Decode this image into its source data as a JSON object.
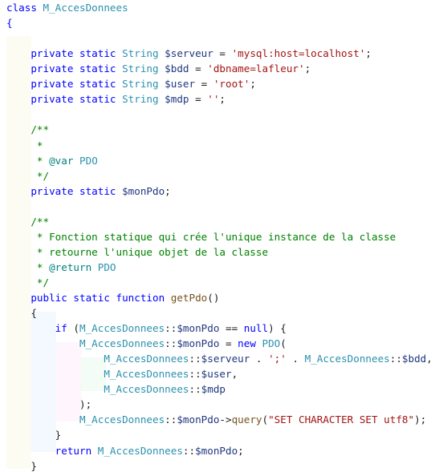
{
  "editor": {
    "lines": [
      {
        "indent": "",
        "tokens": [
          {
            "c": "kw",
            "t": "class "
          },
          {
            "c": "nm",
            "t": "M_AccesDonnees"
          }
        ]
      },
      {
        "indent": "",
        "tokens": [
          {
            "c": "kw",
            "t": "{"
          }
        ]
      },
      {
        "indent": "",
        "tokens": []
      },
      {
        "indent": "    ",
        "tokens": [
          {
            "c": "kw",
            "t": "private static "
          },
          {
            "c": "ty",
            "t": "String "
          },
          {
            "c": "vr",
            "t": "$serveur"
          },
          {
            "c": "pl",
            "t": " = "
          },
          {
            "c": "st",
            "t": "'mysql:host=localhost'"
          },
          {
            "c": "pl",
            "t": ";"
          }
        ]
      },
      {
        "indent": "    ",
        "tokens": [
          {
            "c": "kw",
            "t": "private static "
          },
          {
            "c": "ty",
            "t": "String "
          },
          {
            "c": "vr",
            "t": "$bdd"
          },
          {
            "c": "pl",
            "t": " = "
          },
          {
            "c": "st",
            "t": "'dbname=lafleur'"
          },
          {
            "c": "pl",
            "t": ";"
          }
        ]
      },
      {
        "indent": "    ",
        "tokens": [
          {
            "c": "kw",
            "t": "private static "
          },
          {
            "c": "ty",
            "t": "String "
          },
          {
            "c": "vr",
            "t": "$user"
          },
          {
            "c": "pl",
            "t": " = "
          },
          {
            "c": "st",
            "t": "'root'"
          },
          {
            "c": "pl",
            "t": ";"
          }
        ]
      },
      {
        "indent": "    ",
        "tokens": [
          {
            "c": "kw",
            "t": "private static "
          },
          {
            "c": "ty",
            "t": "String "
          },
          {
            "c": "vr",
            "t": "$mdp"
          },
          {
            "c": "pl",
            "t": " = "
          },
          {
            "c": "st",
            "t": "''"
          },
          {
            "c": "pl",
            "t": ";"
          }
        ]
      },
      {
        "indent": "",
        "tokens": []
      },
      {
        "indent": "    ",
        "tokens": [
          {
            "c": "cm",
            "t": "/**"
          }
        ]
      },
      {
        "indent": "    ",
        "tokens": [
          {
            "c": "cm",
            "t": " *"
          }
        ]
      },
      {
        "indent": "    ",
        "tokens": [
          {
            "c": "cm",
            "t": " * "
          },
          {
            "c": "dc",
            "t": "@var"
          },
          {
            "c": "cm",
            "t": " "
          },
          {
            "c": "ty",
            "t": "PDO"
          }
        ]
      },
      {
        "indent": "    ",
        "tokens": [
          {
            "c": "cm",
            "t": " */"
          }
        ]
      },
      {
        "indent": "    ",
        "tokens": [
          {
            "c": "kw",
            "t": "private static "
          },
          {
            "c": "vr",
            "t": "$monPdo"
          },
          {
            "c": "pl",
            "t": ";"
          }
        ]
      },
      {
        "indent": "",
        "tokens": []
      },
      {
        "indent": "    ",
        "tokens": [
          {
            "c": "cm",
            "t": "/**"
          }
        ]
      },
      {
        "indent": "    ",
        "tokens": [
          {
            "c": "cm",
            "t": " * Fonction statique qui crée l'unique instance de la classe"
          }
        ]
      },
      {
        "indent": "    ",
        "tokens": [
          {
            "c": "cm",
            "t": " * retourne l'unique objet de la classe"
          }
        ]
      },
      {
        "indent": "    ",
        "tokens": [
          {
            "c": "cm",
            "t": " * "
          },
          {
            "c": "dc",
            "t": "@return"
          },
          {
            "c": "cm",
            "t": " "
          },
          {
            "c": "ty",
            "t": "PDO"
          }
        ]
      },
      {
        "indent": "    ",
        "tokens": [
          {
            "c": "cm",
            "t": " */"
          }
        ]
      },
      {
        "indent": "    ",
        "tokens": [
          {
            "c": "kw",
            "t": "public static function "
          },
          {
            "c": "fn",
            "t": "getPdo"
          },
          {
            "c": "pl",
            "t": "()"
          }
        ]
      },
      {
        "indent": "    ",
        "tokens": [
          {
            "c": "pl",
            "t": "{"
          }
        ]
      },
      {
        "indent": "        ",
        "tokens": [
          {
            "c": "kw",
            "t": "if "
          },
          {
            "c": "pl",
            "t": "("
          },
          {
            "c": "nm",
            "t": "M_AccesDonnees"
          },
          {
            "c": "pl",
            "t": "::"
          },
          {
            "c": "vr",
            "t": "$monPdo"
          },
          {
            "c": "pl",
            "t": " == "
          },
          {
            "c": "kw",
            "t": "null"
          },
          {
            "c": "pl",
            "t": ") {"
          }
        ]
      },
      {
        "indent": "            ",
        "tokens": [
          {
            "c": "nm",
            "t": "M_AccesDonnees"
          },
          {
            "c": "pl",
            "t": "::"
          },
          {
            "c": "vr",
            "t": "$monPdo"
          },
          {
            "c": "pl",
            "t": " = "
          },
          {
            "c": "kw",
            "t": "new "
          },
          {
            "c": "ty",
            "t": "PDO"
          },
          {
            "c": "pl",
            "t": "("
          }
        ]
      },
      {
        "indent": "                ",
        "tokens": [
          {
            "c": "nm",
            "t": "M_AccesDonnees"
          },
          {
            "c": "pl",
            "t": "::"
          },
          {
            "c": "vr",
            "t": "$serveur"
          },
          {
            "c": "pl",
            "t": " . "
          },
          {
            "c": "st",
            "t": "';'"
          },
          {
            "c": "pl",
            "t": " . "
          },
          {
            "c": "nm",
            "t": "M_AccesDonnees"
          },
          {
            "c": "pl",
            "t": "::"
          },
          {
            "c": "vr",
            "t": "$bdd"
          },
          {
            "c": "pl",
            "t": ","
          }
        ]
      },
      {
        "indent": "                ",
        "tokens": [
          {
            "c": "nm",
            "t": "M_AccesDonnees"
          },
          {
            "c": "pl",
            "t": "::"
          },
          {
            "c": "vr",
            "t": "$user"
          },
          {
            "c": "pl",
            "t": ","
          }
        ]
      },
      {
        "indent": "                ",
        "tokens": [
          {
            "c": "nm",
            "t": "M_AccesDonnees"
          },
          {
            "c": "pl",
            "t": "::"
          },
          {
            "c": "vr",
            "t": "$mdp"
          }
        ]
      },
      {
        "indent": "            ",
        "tokens": [
          {
            "c": "pl",
            "t": ");"
          }
        ]
      },
      {
        "indent": "            ",
        "tokens": [
          {
            "c": "nm",
            "t": "M_AccesDonnees"
          },
          {
            "c": "pl",
            "t": "::"
          },
          {
            "c": "vr",
            "t": "$monPdo"
          },
          {
            "c": "pl",
            "t": "->"
          },
          {
            "c": "fn",
            "t": "query"
          },
          {
            "c": "pl",
            "t": "("
          },
          {
            "c": "st",
            "t": "\"SET CHARACTER SET utf8\""
          },
          {
            "c": "pl",
            "t": ");"
          }
        ]
      },
      {
        "indent": "        ",
        "tokens": [
          {
            "c": "pl",
            "t": "}"
          }
        ]
      },
      {
        "indent": "        ",
        "tokens": [
          {
            "c": "kw",
            "t": "return "
          },
          {
            "c": "nm",
            "t": "M_AccesDonnees"
          },
          {
            "c": "pl",
            "t": "::"
          },
          {
            "c": "vr",
            "t": "$monPdo"
          },
          {
            "c": "pl",
            "t": ";"
          }
        ]
      },
      {
        "indent": "    ",
        "tokens": [
          {
            "c": "pl",
            "t": "}"
          }
        ]
      }
    ]
  }
}
